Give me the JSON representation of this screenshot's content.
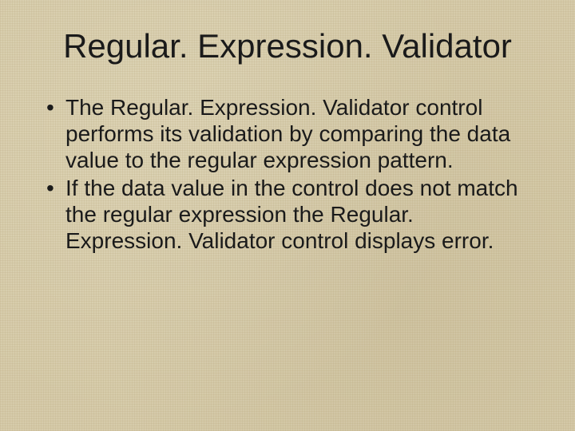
{
  "slide": {
    "title": "Regular. Expression. Validator",
    "bullets": [
      "The Regular. Expression. Validator control performs its validation by comparing the data value to the regular expression pattern.",
      "If the data value in the control does not match the regular expression  the Regular. Expression. Validator control displays error."
    ]
  }
}
